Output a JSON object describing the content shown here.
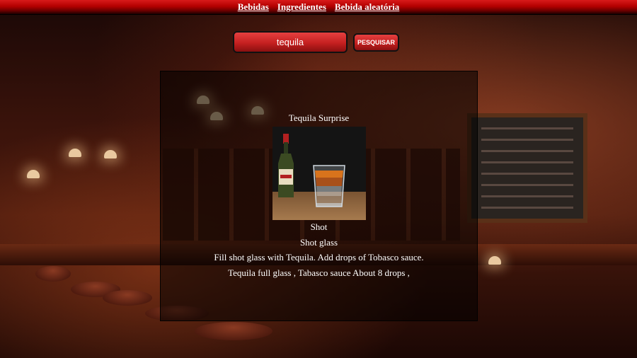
{
  "nav": {
    "links": [
      "Bebidas",
      "Ingredientes",
      "Bebida aleatória"
    ]
  },
  "search": {
    "value": "tequila",
    "button_label": "PESQUISAR"
  },
  "result": {
    "name": "Tequila Surprise",
    "category": "Shot",
    "glass": "Shot glass",
    "instructions": "Fill shot glass with Tequila. Add drops of Tobasco sauce.",
    "ingredients": "Tequila full glass , Tabasco sauce About 8 drops ,"
  },
  "colors": {
    "accent_red": "#c52020",
    "text": "#ffffff"
  }
}
